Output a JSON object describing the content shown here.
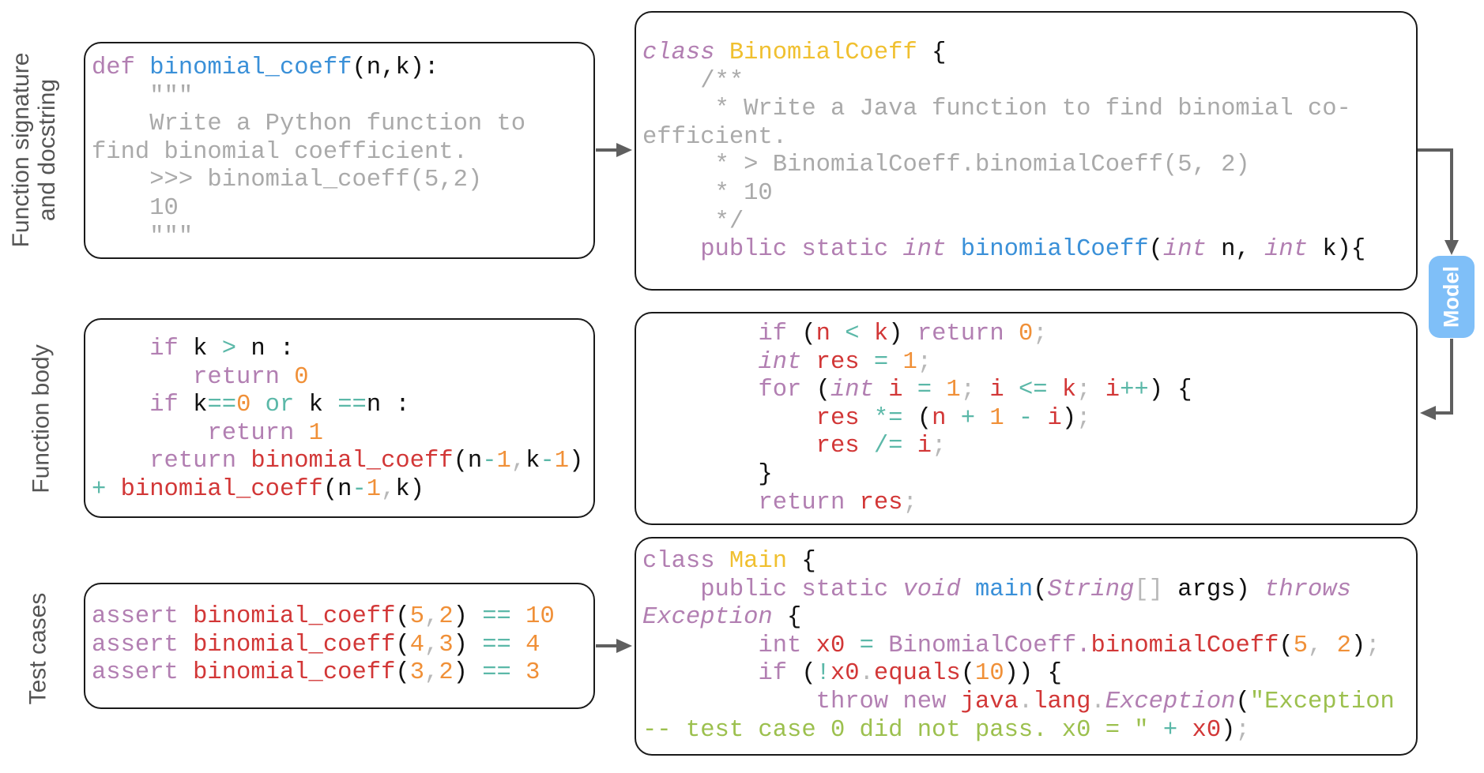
{
  "row_labels": {
    "signature": [
      "Function signature",
      "and docstring"
    ],
    "body": "Function body",
    "tests": "Test cases"
  },
  "model_label": "Model",
  "colors": {
    "keyword": "#b27fb2",
    "function": "#3a90d8",
    "identifier": "#d23737",
    "number": "#f09038",
    "operator": "#5bb8a8",
    "comment": "#aaaaaa",
    "class": "#f0c030",
    "string": "#9cc04e",
    "model_badge": "#7fbff8",
    "arrow": "#5f5f5f"
  },
  "python": {
    "signature": [
      [
        [
          "def ",
          "kw"
        ],
        [
          "binomial_coeff",
          "fn"
        ],
        [
          "(n,k):",
          "pl"
        ]
      ],
      [
        [
          "    \"\"\"",
          "cm"
        ]
      ],
      [
        [
          "    Write a Python function to",
          "cm"
        ]
      ],
      [
        [
          "find binomial coefficient.",
          "cm"
        ]
      ],
      [
        [
          "    >>> binomial_coeff(5,2)",
          "cm"
        ]
      ],
      [
        [
          "    10",
          "cm"
        ]
      ],
      [
        [
          "    \"\"\"",
          "cm"
        ]
      ]
    ],
    "body": [
      [
        [
          "    ",
          "pl"
        ],
        [
          "if ",
          "kw"
        ],
        [
          "k ",
          "pl"
        ],
        [
          "> ",
          "op"
        ],
        [
          "n :",
          "pl"
        ]
      ],
      [
        [
          "       ",
          "pl"
        ],
        [
          "return ",
          "kw"
        ],
        [
          "0",
          "num"
        ]
      ],
      [
        [
          "    ",
          "pl"
        ],
        [
          "if ",
          "kw"
        ],
        [
          "k",
          "pl"
        ],
        [
          "==",
          "op"
        ],
        [
          "0 ",
          "num"
        ],
        [
          "or ",
          "op"
        ],
        [
          "k ",
          "pl"
        ],
        [
          "==",
          "op"
        ],
        [
          "n :",
          "pl"
        ]
      ],
      [
        [
          "        ",
          "pl"
        ],
        [
          "return ",
          "kw"
        ],
        [
          "1",
          "num"
        ]
      ],
      [
        [
          "    ",
          "pl"
        ],
        [
          "return ",
          "kw"
        ],
        [
          "binomial_coeff",
          "id"
        ],
        [
          "(n",
          "pl"
        ],
        [
          "-",
          "op"
        ],
        [
          "1",
          "num"
        ],
        [
          ",",
          "dim"
        ],
        [
          "k",
          "pl"
        ],
        [
          "-",
          "op"
        ],
        [
          "1",
          "num"
        ],
        [
          ")",
          "pl"
        ]
      ],
      [
        [
          "+ ",
          "op"
        ],
        [
          "binomial_coeff",
          "id"
        ],
        [
          "(n",
          "pl"
        ],
        [
          "-",
          "op"
        ],
        [
          "1",
          "num"
        ],
        [
          ",",
          "dim"
        ],
        [
          "k)",
          "pl"
        ]
      ]
    ],
    "tests": [
      [
        [
          "assert ",
          "kw"
        ],
        [
          "binomial_coeff",
          "id"
        ],
        [
          "(",
          "pl"
        ],
        [
          "5",
          "num"
        ],
        [
          ",",
          "dim"
        ],
        [
          "2",
          "num"
        ],
        [
          ") ",
          "pl"
        ],
        [
          "== ",
          "op"
        ],
        [
          "10",
          "num"
        ]
      ],
      [
        [
          "assert ",
          "kw"
        ],
        [
          "binomial_coeff",
          "id"
        ],
        [
          "(",
          "pl"
        ],
        [
          "4",
          "num"
        ],
        [
          ",",
          "dim"
        ],
        [
          "3",
          "num"
        ],
        [
          ") ",
          "pl"
        ],
        [
          "== ",
          "op"
        ],
        [
          "4",
          "num"
        ]
      ],
      [
        [
          "assert ",
          "kw"
        ],
        [
          "binomial_coeff",
          "id"
        ],
        [
          "(",
          "pl"
        ],
        [
          "3",
          "num"
        ],
        [
          ",",
          "dim"
        ],
        [
          "2",
          "num"
        ],
        [
          ") ",
          "pl"
        ],
        [
          "== ",
          "op"
        ],
        [
          "3",
          "num"
        ]
      ]
    ]
  },
  "java": {
    "signature": [
      [
        [
          "class ",
          "kwi"
        ],
        [
          "BinomialCoeff ",
          "cls"
        ],
        [
          "{",
          "pl"
        ]
      ],
      [
        [
          "    /**",
          "cm"
        ]
      ],
      [
        [
          "     * Write a Java function to find binomial co-",
          "cm"
        ]
      ],
      [
        [
          "efficient.",
          "cm"
        ]
      ],
      [
        [
          "     * > BinomialCoeff.binomialCoeff(5, 2)",
          "cm"
        ]
      ],
      [
        [
          "     * 10",
          "cm"
        ]
      ],
      [
        [
          "     */",
          "cm"
        ]
      ],
      [
        [
          "    ",
          "pl"
        ],
        [
          "public static ",
          "kw"
        ],
        [
          "int ",
          "kwi"
        ],
        [
          "binomialCoeff",
          "fn"
        ],
        [
          "(",
          "pl"
        ],
        [
          "int ",
          "kwi"
        ],
        [
          "n, ",
          "pl"
        ],
        [
          "int ",
          "kwi"
        ],
        [
          "k){",
          "pl"
        ]
      ]
    ],
    "body": [
      [
        [
          "        ",
          "pl"
        ],
        [
          "if ",
          "kw"
        ],
        [
          "(",
          "pl"
        ],
        [
          "n ",
          "id"
        ],
        [
          "< ",
          "op"
        ],
        [
          "k",
          "id"
        ],
        [
          ") ",
          "pl"
        ],
        [
          "return ",
          "kw"
        ],
        [
          "0",
          "num"
        ],
        [
          ";",
          "dim"
        ]
      ],
      [
        [
          "        ",
          "pl"
        ],
        [
          "int ",
          "kwi"
        ],
        [
          "res ",
          "id"
        ],
        [
          "= ",
          "op"
        ],
        [
          "1",
          "num"
        ],
        [
          ";",
          "dim"
        ]
      ],
      [
        [
          "        ",
          "pl"
        ],
        [
          "for ",
          "kw"
        ],
        [
          "(",
          "pl"
        ],
        [
          "int ",
          "kwi"
        ],
        [
          "i ",
          "id"
        ],
        [
          "= ",
          "op"
        ],
        [
          "1",
          "num"
        ],
        [
          "; ",
          "dim"
        ],
        [
          "i ",
          "id"
        ],
        [
          "<= ",
          "op"
        ],
        [
          "k",
          "id"
        ],
        [
          "; ",
          "dim"
        ],
        [
          "i",
          "id"
        ],
        [
          "++",
          "op"
        ],
        [
          ") {",
          "pl"
        ]
      ],
      [
        [
          "            ",
          "pl"
        ],
        [
          "res ",
          "id"
        ],
        [
          "*= ",
          "op"
        ],
        [
          "(",
          "pl"
        ],
        [
          "n ",
          "id"
        ],
        [
          "+ ",
          "op"
        ],
        [
          "1 ",
          "num"
        ],
        [
          "- ",
          "op"
        ],
        [
          "i",
          "id"
        ],
        [
          ")",
          "pl"
        ],
        [
          ";",
          "dim"
        ]
      ],
      [
        [
          "            ",
          "pl"
        ],
        [
          "res ",
          "id"
        ],
        [
          "/= ",
          "op"
        ],
        [
          "i",
          "id"
        ],
        [
          ";",
          "dim"
        ]
      ],
      [
        [
          "        }",
          "pl"
        ]
      ],
      [
        [
          "        ",
          "pl"
        ],
        [
          "return ",
          "kw"
        ],
        [
          "res",
          "id"
        ],
        [
          ";",
          "dim"
        ]
      ]
    ],
    "tests": [
      [
        [
          "class ",
          "kw"
        ],
        [
          "Main ",
          "cls"
        ],
        [
          "{",
          "pl"
        ]
      ],
      [
        [
          "    ",
          "pl"
        ],
        [
          "public static ",
          "kw"
        ],
        [
          "void ",
          "kwi"
        ],
        [
          "main",
          "fn"
        ],
        [
          "(",
          "pl"
        ],
        [
          "String",
          "kwi"
        ],
        [
          "[] ",
          "dim"
        ],
        [
          "args) ",
          "pl"
        ],
        [
          "throws",
          "kwi"
        ]
      ],
      [
        [
          "Exception ",
          "kwi"
        ],
        [
          "{",
          "pl"
        ]
      ],
      [
        [
          "        ",
          "pl"
        ],
        [
          "int ",
          "kw"
        ],
        [
          "x0 ",
          "id"
        ],
        [
          "= ",
          "op"
        ],
        [
          "BinomialCoeff.",
          "kw"
        ],
        [
          "binomialCoeff",
          "id"
        ],
        [
          "(",
          "pl"
        ],
        [
          "5",
          "num"
        ],
        [
          ", ",
          "dim"
        ],
        [
          "2",
          "num"
        ],
        [
          ")",
          "pl"
        ],
        [
          ";",
          "dim"
        ]
      ],
      [
        [
          "        ",
          "pl"
        ],
        [
          "if ",
          "kw"
        ],
        [
          "(",
          "pl"
        ],
        [
          "!",
          "op"
        ],
        [
          "x0",
          "id"
        ],
        [
          ".",
          "dim"
        ],
        [
          "equals",
          "id"
        ],
        [
          "(",
          "pl"
        ],
        [
          "10",
          "num"
        ],
        [
          ")) {",
          "pl"
        ]
      ],
      [
        [
          "            ",
          "pl"
        ],
        [
          "throw new ",
          "kw"
        ],
        [
          "java",
          "id"
        ],
        [
          ".",
          "dim"
        ],
        [
          "lang",
          "id"
        ],
        [
          ".",
          "dim"
        ],
        [
          "Exception",
          "kwi"
        ],
        [
          "(",
          "pl"
        ],
        [
          "\"Exception",
          "str"
        ]
      ],
      [
        [
          "-- test case 0 did not pass. x0 = \" ",
          "str"
        ],
        [
          "+ ",
          "op"
        ],
        [
          "x0",
          "id"
        ],
        [
          ")",
          "pl"
        ],
        [
          ";",
          "dim"
        ]
      ]
    ]
  }
}
